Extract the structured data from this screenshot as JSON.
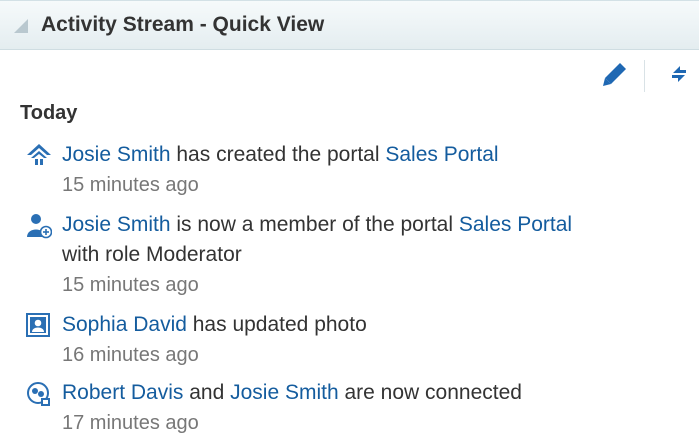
{
  "header": {
    "title": "Activity Stream - Quick View",
    "disclosure_icon": "triangle-disclosure-icon"
  },
  "toolbar": {
    "edit_icon": "pencil-icon",
    "refresh_icon": "refresh-arrows-icon"
  },
  "group": {
    "label": "Today"
  },
  "colors": {
    "link": "#145c9e",
    "icon": "#2a6fb4",
    "muted": "#777777",
    "header_bg": "#e8f0f3"
  },
  "activities": [
    {
      "icon": "portal-icon",
      "actor": "Josie Smith",
      "text1": " has created the portal ",
      "target": "Sales Portal",
      "time": "15 minutes ago"
    },
    {
      "icon": "user-add-icon",
      "actor": "Josie Smith",
      "text1": " is now a member of the portal ",
      "target": "Sales Portal",
      "line2": "with role Moderator",
      "time": "15 minutes ago"
    },
    {
      "icon": "photo-icon",
      "actor": "Sophia David",
      "text1": " has updated photo",
      "time": "16 minutes ago"
    },
    {
      "icon": "connection-icon",
      "actor": "Robert Davis",
      "text1": " and ",
      "actor2": "Josie Smith",
      "text2": " are now connected",
      "time": "17 minutes ago"
    }
  ]
}
